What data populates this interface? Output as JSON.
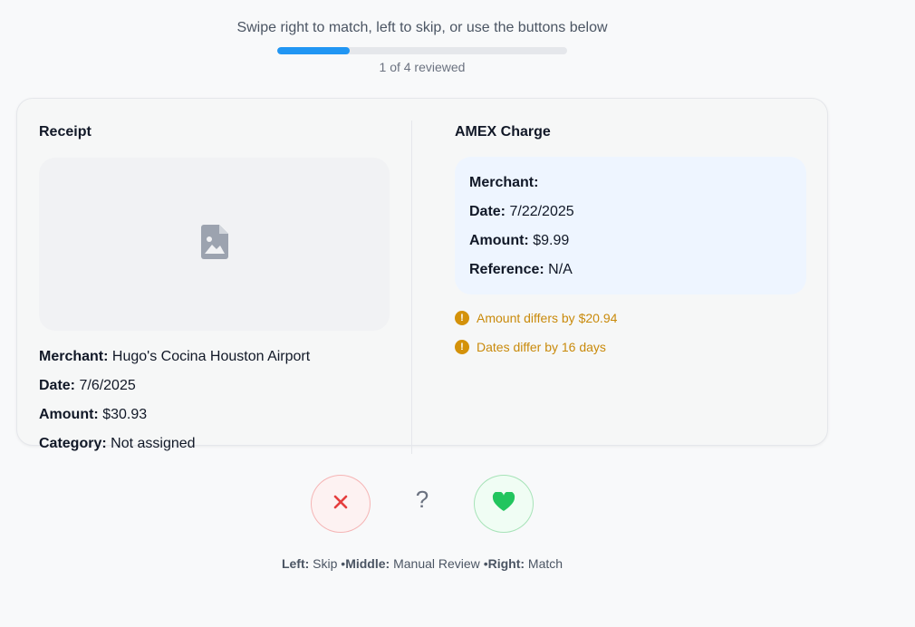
{
  "header": {
    "instruction": "Swipe right to match, left to skip, or use the buttons below",
    "progress_text": "1 of 4 reviewed",
    "progress_fraction": 0.25
  },
  "receipt": {
    "title": "Receipt",
    "image_icon": "image-file-icon",
    "merchant_label": "Merchant:",
    "merchant_value": "Hugo's Cocina Houston Airport",
    "date_label": "Date:",
    "date_value": "7/6/2025",
    "amount_label": "Amount:",
    "amount_value": "$30.93",
    "category_label": "Category:",
    "category_value": "Not assigned"
  },
  "amex": {
    "title": "AMEX Charge",
    "merchant_label": "Merchant:",
    "merchant_value": "",
    "date_label": "Date:",
    "date_value": "7/22/2025",
    "amount_label": "Amount:",
    "amount_value": "$9.99",
    "reference_label": "Reference:",
    "reference_value": "N/A"
  },
  "warnings": [
    {
      "icon": "!",
      "text": "Amount differs by $20.94"
    },
    {
      "icon": "!",
      "text": "Dates differ by 16 days"
    }
  ],
  "actions": {
    "skip_icon": "✕",
    "review_icon": "?",
    "match_icon": "heart-icon"
  },
  "legend": {
    "left_label": "Left:",
    "left_value": "Skip",
    "sep1": "•",
    "middle_label": "Middle:",
    "middle_value": "Manual Review",
    "sep2": "•",
    "right_label": "Right:",
    "right_value": "Match"
  },
  "colors": {
    "accent": "#2196f3",
    "skip": "#e53e3e",
    "match": "#22c55e",
    "warning": "#c98a0b"
  }
}
